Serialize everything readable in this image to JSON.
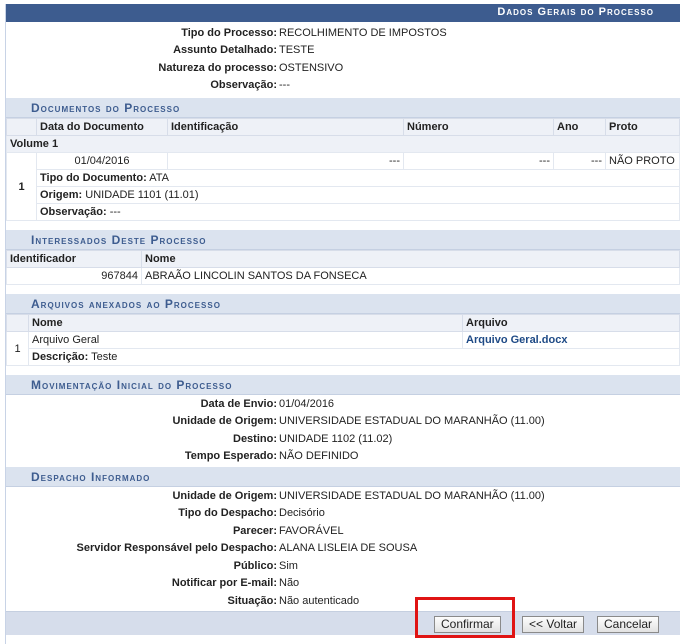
{
  "header": {
    "title": "Dados Gerais do Processo"
  },
  "general": [
    {
      "label": "Tipo do Processo:",
      "value": "RECOLHIMENTO DE IMPOSTOS"
    },
    {
      "label": "Assunto Detalhado:",
      "value": "TESTE"
    },
    {
      "label": "Natureza do processo:",
      "value": "OSTENSIVO"
    },
    {
      "label": "Observação:",
      "value": "---"
    }
  ],
  "documentos": {
    "title": "Documentos do Processo",
    "columns": [
      "Data do Documento",
      "Identificação",
      "Número",
      "Ano",
      "Proto"
    ],
    "volume": "Volume 1",
    "row": {
      "index": "1",
      "data": "01/04/2016",
      "identificacao": "---",
      "numero": "---",
      "ano": "---",
      "protocolo": "NÃO PROTO",
      "tipo_label": "Tipo do Documento:",
      "tipo": "ATA",
      "origem_label": "Origem:",
      "origem": "UNIDADE 1101 (11.01)",
      "obs_label": "Observação:",
      "obs": "---"
    }
  },
  "interessados": {
    "title": "Interessados Deste Processo",
    "columns": [
      "Identificador",
      "Nome"
    ],
    "row": {
      "id": "967844",
      "nome": "ABRAÃO LINCOLIN SANTOS DA FONSECA"
    }
  },
  "arquivos": {
    "title": "Arquivos anexados ao Processo",
    "columns": [
      "Nome",
      "Arquivo"
    ],
    "row": {
      "index": "1",
      "nome": "Arquivo Geral",
      "arquivo": "Arquivo Geral.docx",
      "desc_label": "Descrição:",
      "desc": "Teste"
    }
  },
  "movimentacao": {
    "title": "Movimentação Inicial do Processo",
    "fields": [
      {
        "label": "Data de Envio:",
        "value": "01/04/2016"
      },
      {
        "label": "Unidade de Origem:",
        "value": "UNIVERSIDADE ESTADUAL DO MARANHÃO (11.00)"
      },
      {
        "label": "Destino:",
        "value": "UNIDADE 1102 (11.02)"
      },
      {
        "label": "Tempo Esperado:",
        "value": "NÃO DEFINIDO"
      }
    ]
  },
  "despacho": {
    "title": "Despacho Informado",
    "fields": [
      {
        "label": "Unidade de Origem:",
        "value": "UNIVERSIDADE ESTADUAL DO MARANHÃO (11.00)"
      },
      {
        "label": "Tipo do Despacho:",
        "value": "Decisório"
      },
      {
        "label": "Parecer:",
        "value": "FAVORÁVEL"
      },
      {
        "label": "Servidor Responsável pelo Despacho:",
        "value": "ALANA LISLEIA DE SOUSA"
      },
      {
        "label": "Público:",
        "value": "Sim"
      },
      {
        "label": "Notificar por E-mail:",
        "value": "Não"
      },
      {
        "label": "Situação:",
        "value": "Não autenticado"
      }
    ]
  },
  "buttons": {
    "confirmar": "Confirmar",
    "voltar": "<< Voltar",
    "cancelar": "Cancelar"
  },
  "colors": {
    "header_bg": "#3d5c8f",
    "section_bg": "#dbe3ef",
    "highlight": "#e01414"
  }
}
